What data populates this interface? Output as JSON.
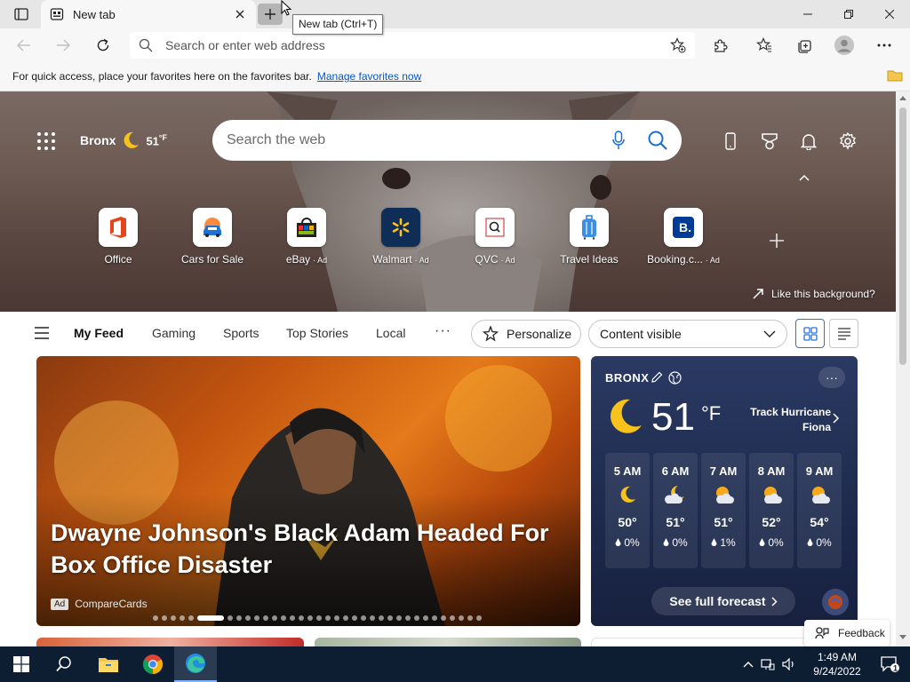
{
  "browser": {
    "tab_title": "New tab",
    "newtab_tooltip": "New tab (Ctrl+T)",
    "address_placeholder": "Search or enter web address",
    "favorites_hint": "For quick access, place your favorites here on the favorites bar.",
    "manage_favorites": "Manage favorites now"
  },
  "hero": {
    "location": "Bronx",
    "temp": "51",
    "unit": "°F",
    "search_placeholder": "Search the web",
    "like_background": "Like this background?",
    "quick_links": [
      {
        "label": "Office",
        "ad": ""
      },
      {
        "label": "Cars for Sale",
        "ad": ""
      },
      {
        "label": "eBay",
        "ad": "· Ad"
      },
      {
        "label": "Walmart",
        "ad": "· Ad"
      },
      {
        "label": "QVC",
        "ad": "· Ad"
      },
      {
        "label": "Travel Ideas",
        "ad": ""
      },
      {
        "label": "Booking.c...",
        "ad": "· Ad"
      }
    ]
  },
  "feed": {
    "tabs": [
      "My Feed",
      "Gaming",
      "Sports",
      "Top Stories",
      "Local"
    ],
    "more": "···",
    "personalize": "Personalize",
    "content_visible": "Content visible"
  },
  "news": {
    "title": "Dwayne Johnson's Black Adam Headed For Box Office Disaster",
    "ad_badge": "Ad",
    "source": "CompareCards"
  },
  "weather": {
    "city": "BRONX",
    "temp": "51",
    "unit": "°F",
    "alert": "Track Hurricane Fiona",
    "hours": [
      {
        "time": "5 AM",
        "temp": "50°",
        "precip": "0%",
        "icon": "moon"
      },
      {
        "time": "6 AM",
        "temp": "51°",
        "precip": "0%",
        "icon": "cloud-moon"
      },
      {
        "time": "7 AM",
        "temp": "51°",
        "precip": "1%",
        "icon": "cloud-sun"
      },
      {
        "time": "8 AM",
        "temp": "52°",
        "precip": "0%",
        "icon": "cloud-sun"
      },
      {
        "time": "9 AM",
        "temp": "54°",
        "precip": "0%",
        "icon": "cloud-sun"
      }
    ],
    "forecast_btn": "See full forecast"
  },
  "feedback": "Feedback",
  "taskbar": {
    "time": "1:49 AM",
    "date": "9/24/2022",
    "notif_count": "1"
  }
}
